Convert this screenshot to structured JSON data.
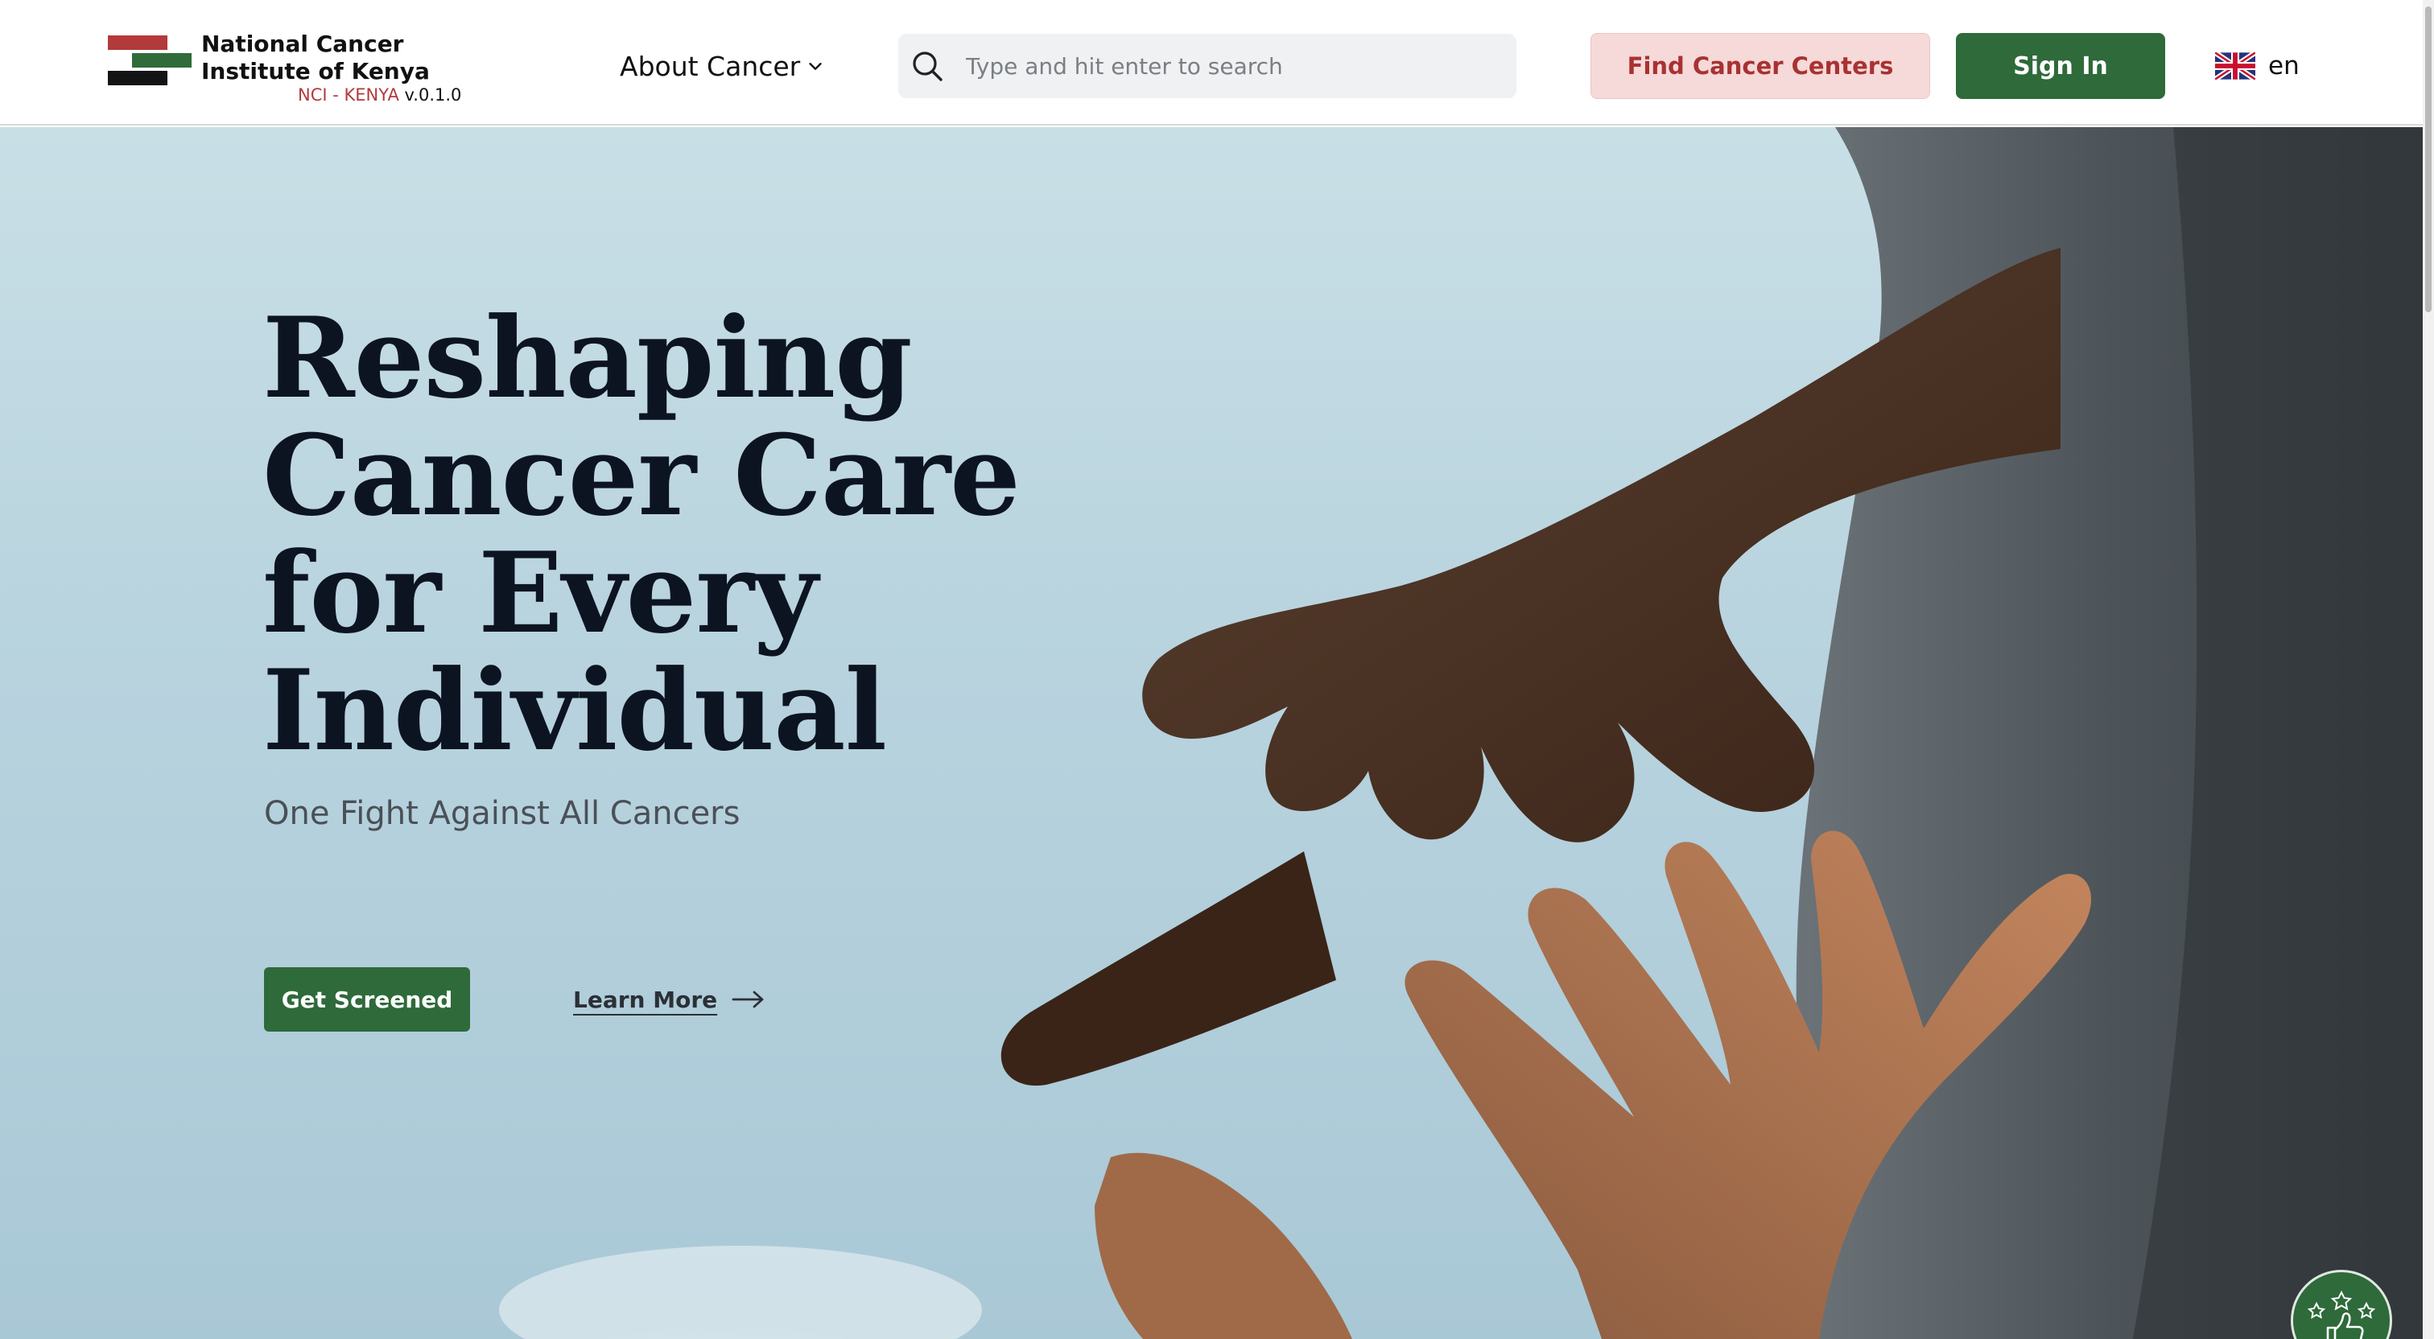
{
  "brand": {
    "name": "National Cancer Institute of Kenya",
    "short": "NCI - KENYA",
    "version": "v.0.1.0",
    "colors": {
      "red": "#b23a3a",
      "green": "#2f6b3b",
      "black": "#141414"
    }
  },
  "nav": {
    "about_label": "About Cancer",
    "about_icon": "chevron-down-icon"
  },
  "search": {
    "placeholder": "Type and hit enter to search",
    "value": "",
    "icon": "search-icon"
  },
  "actions": {
    "find_centers": "Find Cancer Centers",
    "sign_in": "Sign In"
  },
  "language": {
    "code": "en",
    "icon": "uk-flag-icon"
  },
  "hero": {
    "title": "Reshaping Cancer Care for Every Individual",
    "subtitle": "One Fight Against All Cancers",
    "primary_cta": "Get Screened",
    "secondary_cta": "Learn More",
    "secondary_icon": "arrow-right-icon"
  },
  "feedback": {
    "icon": "rating-thumbs-up-icon"
  },
  "theme": {
    "primary_green": "#2e6a3a",
    "soft_red": "#f6d9d9",
    "sky": "#b9d4df"
  }
}
